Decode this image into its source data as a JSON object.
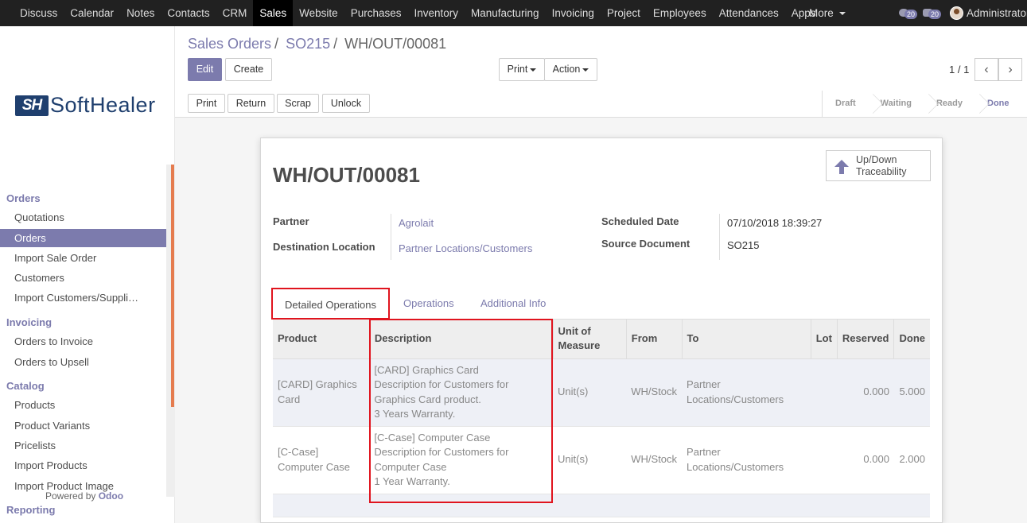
{
  "topbar": {
    "menu": [
      "Discuss",
      "Calendar",
      "Notes",
      "Contacts",
      "CRM",
      "Sales",
      "Website",
      "Purchases",
      "Inventory",
      "Manufacturing",
      "Invoicing",
      "Project",
      "Employees",
      "Attendances",
      "Apps"
    ],
    "active": "Sales",
    "more": "More",
    "messages_count": "20",
    "activities_count": "20",
    "user": "Administrator"
  },
  "sidebar": {
    "logo_mark": "SH",
    "logo_text": "SoftHealer",
    "sections": [
      {
        "title": "Orders",
        "items": [
          "Quotations",
          "Orders",
          "Import Sale Order",
          "Customers",
          "Import Customers/Suppli…"
        ]
      },
      {
        "title": "Invoicing",
        "items": [
          "Orders to Invoice",
          "Orders to Upsell"
        ]
      },
      {
        "title": "Catalog",
        "items": [
          "Products",
          "Product Variants",
          "Pricelists",
          "Import Products",
          "Import Product Image"
        ]
      },
      {
        "title": "Reporting",
        "items": []
      }
    ],
    "active_item": "Orders",
    "powered_prefix": "Powered by",
    "powered_brand": "Odoo"
  },
  "breadcrumb": [
    "Sales Orders",
    "SO215",
    "WH/OUT/00081"
  ],
  "controls": {
    "edit": "Edit",
    "create": "Create",
    "print": "Print",
    "action": "Action",
    "pager": "1 / 1"
  },
  "header_buttons": [
    "Print",
    "Return",
    "Scrap",
    "Unlock"
  ],
  "status_steps": [
    "Draft",
    "Waiting",
    "Ready",
    "Done"
  ],
  "status_current": "Done",
  "record": {
    "title": "WH/OUT/00081",
    "smart_button": [
      "Up/Down",
      "Traceability"
    ],
    "partner_label": "Partner",
    "partner": "Agrolait",
    "dest_label": "Destination Location",
    "dest": "Partner Locations/Customers",
    "scheduled_label": "Scheduled Date",
    "scheduled": "07/10/2018 18:39:27",
    "source_label": "Source Document",
    "source": "SO215"
  },
  "tabs": [
    "Detailed Operations",
    "Operations",
    "Additional Info"
  ],
  "table": {
    "headers": [
      "Product",
      "Description",
      "Unit of Measure",
      "From",
      "To",
      "Lot",
      "Reserved",
      "Done"
    ],
    "rows": [
      {
        "product": "[CARD] Graphics Card",
        "description": [
          "[CARD] Graphics Card",
          "Description for Customers for",
          "Graphics Card product.",
          "3 Years Warranty."
        ],
        "uom": "Unit(s)",
        "from": "WH/Stock",
        "to": "Partner Locations/Customers",
        "lot": "",
        "reserved": "0.000",
        "done": "5.000"
      },
      {
        "product": "[C-Case] Computer Case",
        "description": [
          "[C-Case] Computer Case",
          "Description for Customers for",
          "Computer Case",
          "1 Year Warranty."
        ],
        "uom": "Unit(s)",
        "from": "WH/Stock",
        "to": "Partner Locations/Customers",
        "lot": "",
        "reserved": "0.000",
        "done": "2.000"
      }
    ]
  },
  "colors": {
    "brand": "#7c7bad",
    "highlight": "#e0141e",
    "topbar": "#212121"
  }
}
